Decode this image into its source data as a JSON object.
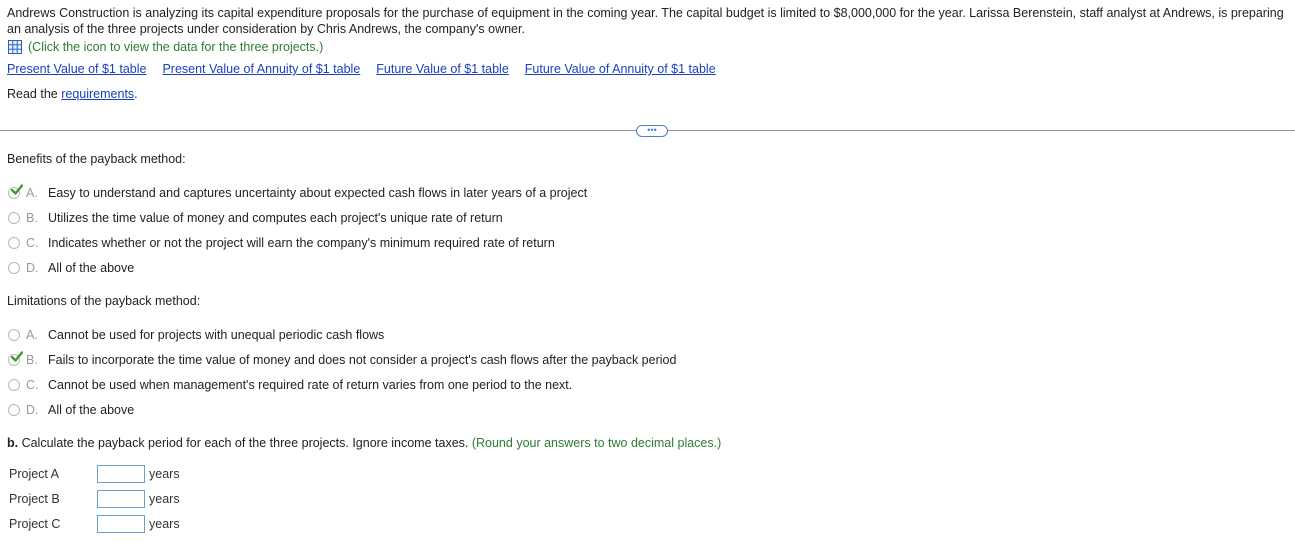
{
  "intro": "Andrews Construction is analyzing its capital expenditure proposals for the purchase of equipment in the coming year. The capital budget is limited to $8,000,000 for the year. Larissa Berenstein, staff analyst at Andrews, is preparing an analysis of the three projects under consideration by Chris Andrews, the company's owner.",
  "data_link": "(Click the icon to view the data for the three projects.)",
  "tables": [
    "Present Value of $1 table",
    "Present Value of Annuity of $1 table",
    "Future Value of $1 table",
    "Future Value of Annuity of $1 table"
  ],
  "requirements": {
    "prefix": "Read the ",
    "link": "requirements",
    "suffix": "."
  },
  "more_button": "•••",
  "benefits": {
    "label": "Benefits of the payback method:",
    "options": [
      {
        "letter": "A.",
        "text": "Easy to understand and captures uncertainty about expected cash flows in later years of a project",
        "correct": true
      },
      {
        "letter": "B.",
        "text": "Utilizes the time value of money and computes each project's unique rate of return",
        "correct": false
      },
      {
        "letter": "C.",
        "text": "Indicates whether or not the project will earn the company's minimum required rate of return",
        "correct": false
      },
      {
        "letter": "D.",
        "text": "All of the above",
        "correct": false
      }
    ]
  },
  "limitations": {
    "label": "Limitations of the payback method:",
    "options": [
      {
        "letter": "A.",
        "text": "Cannot be used for projects with unequal periodic cash flows",
        "correct": false
      },
      {
        "letter": "B.",
        "text": "Fails to incorporate the time value of money and does not consider a project's cash flows after the payback period",
        "correct": true
      },
      {
        "letter": "C.",
        "text": "Cannot be used when management's required rate of return varies from one period to the next.",
        "correct": false
      },
      {
        "letter": "D.",
        "text": "All of the above",
        "correct": false
      }
    ]
  },
  "part_b": {
    "bold": "b.",
    "text": " Calculate the payback period for each of the three projects. Ignore income taxes. ",
    "hint": "(Round your answers to two decimal places.)"
  },
  "projects": [
    {
      "label": "Project A",
      "value": "",
      "unit": "years"
    },
    {
      "label": "Project B",
      "value": "",
      "unit": "years"
    },
    {
      "label": "Project C",
      "value": "",
      "unit": "years"
    }
  ]
}
